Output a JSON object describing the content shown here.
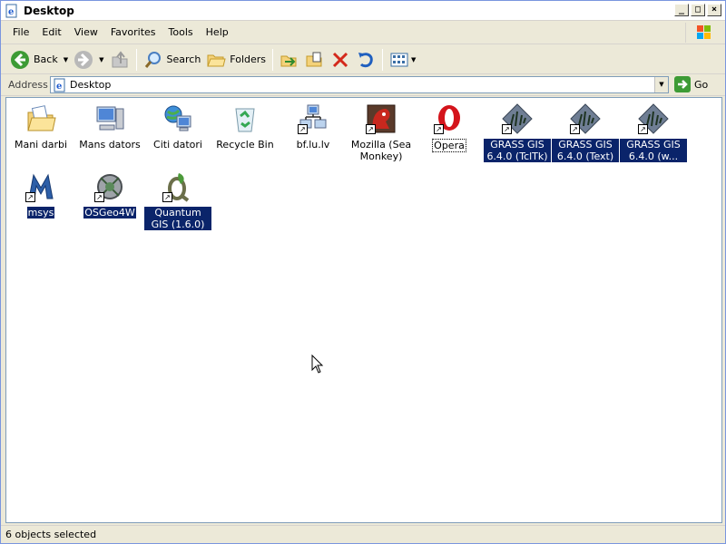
{
  "window": {
    "title": "Desktop"
  },
  "menu": {
    "items": [
      "File",
      "Edit",
      "View",
      "Favorites",
      "Tools",
      "Help"
    ]
  },
  "toolbar": {
    "back_label": "Back",
    "search_label": "Search",
    "folders_label": "Folders"
  },
  "address": {
    "label": "Address",
    "value": "Desktop",
    "go_label": "Go"
  },
  "icons": [
    {
      "label": "Mani darbi",
      "icon": "my-documents-icon",
      "shortcut": false,
      "selected": false
    },
    {
      "label": "Mans dators",
      "icon": "my-computer-icon",
      "shortcut": false,
      "selected": false
    },
    {
      "label": "Citi datori",
      "icon": "network-places-icon",
      "shortcut": false,
      "selected": false
    },
    {
      "label": "Recycle Bin",
      "icon": "recycle-bin-icon",
      "shortcut": false,
      "selected": false
    },
    {
      "label": "bf.lu.lv",
      "icon": "network-drive-icon",
      "shortcut": true,
      "selected": false
    },
    {
      "label": "Mozilla (Sea Monkey)",
      "icon": "seamonkey-icon",
      "shortcut": true,
      "selected": false
    },
    {
      "label": "Opera",
      "icon": "opera-icon",
      "shortcut": true,
      "selected": false,
      "focused": true
    },
    {
      "label": "GRASS GIS 6.4.0 (TclTk)",
      "icon": "grass-gis-icon",
      "shortcut": true,
      "selected": true
    },
    {
      "label": "GRASS GIS 6.4.0 (Text)",
      "icon": "grass-gis-icon",
      "shortcut": true,
      "selected": true
    },
    {
      "label": "GRASS GIS 6.4.0 (w...",
      "icon": "grass-gis-icon",
      "shortcut": true,
      "selected": true
    },
    {
      "label": "msys",
      "icon": "msys-icon",
      "shortcut": true,
      "selected": true
    },
    {
      "label": "OSGeo4W",
      "icon": "osgeo4w-icon",
      "shortcut": true,
      "selected": true
    },
    {
      "label": "Quantum GIS (1.6.0)",
      "icon": "qgis-icon",
      "shortcut": true,
      "selected": true
    }
  ],
  "status": {
    "text": "6 objects selected"
  },
  "colors": {
    "selection": "#0a246a",
    "chrome": "#ece9d8"
  }
}
